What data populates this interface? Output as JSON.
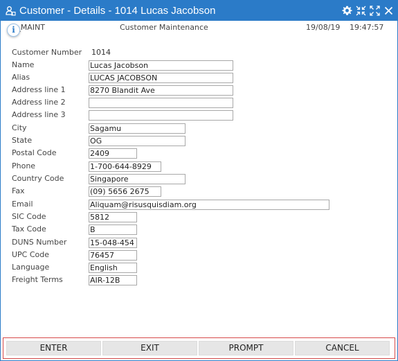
{
  "window": {
    "title": "Customer - Details - 1014 Lucas Jacobson",
    "icons": [
      "user-icon",
      "gear-icon",
      "shrink-icon",
      "expand-icon",
      "close-icon"
    ],
    "accent_color": "#2b7bc8"
  },
  "header": {
    "program": "IS_MAINT",
    "screen_title": "Customer Maintenance",
    "date": "19/08/19",
    "time": "19:47:57",
    "info_badge": "i"
  },
  "form": {
    "customer_number_label": "Customer Number",
    "customer_number": "1014",
    "fields": [
      {
        "label": "Name",
        "value": "Lucas Jacobson"
      },
      {
        "label": "Alias",
        "value": "LUCAS JACOBSON"
      },
      {
        "label": "Address line 1",
        "value": "8270 Blandit Ave"
      },
      {
        "label": "Address line 2",
        "value": ""
      },
      {
        "label": "Address line 3",
        "value": ""
      },
      {
        "label": "City",
        "value": "Sagamu"
      },
      {
        "label": "State",
        "value": "OG"
      },
      {
        "label": "Postal Code",
        "value": "2409"
      },
      {
        "label": "Phone",
        "value": "1-700-644-8929"
      },
      {
        "label": "Country Code",
        "value": "Singapore"
      },
      {
        "label": "Fax",
        "value": "(09) 5656 2675"
      },
      {
        "label": "Email",
        "value": "Aliquam@risusquisdiam.org"
      },
      {
        "label": "SIC Code",
        "value": "5812"
      },
      {
        "label": "Tax Code",
        "value": "B"
      },
      {
        "label": "DUNS Number",
        "value": "15-048-454"
      },
      {
        "label": "UPC Code",
        "value": "76457"
      },
      {
        "label": "Language",
        "value": "English"
      },
      {
        "label": "Freight Terms",
        "value": "AIR-12B"
      }
    ]
  },
  "buttons": {
    "enter": "ENTER",
    "exit": "EXIT",
    "prompt": "PROMPT",
    "cancel": "CANCEL",
    "border_color": "#d64a4a"
  }
}
